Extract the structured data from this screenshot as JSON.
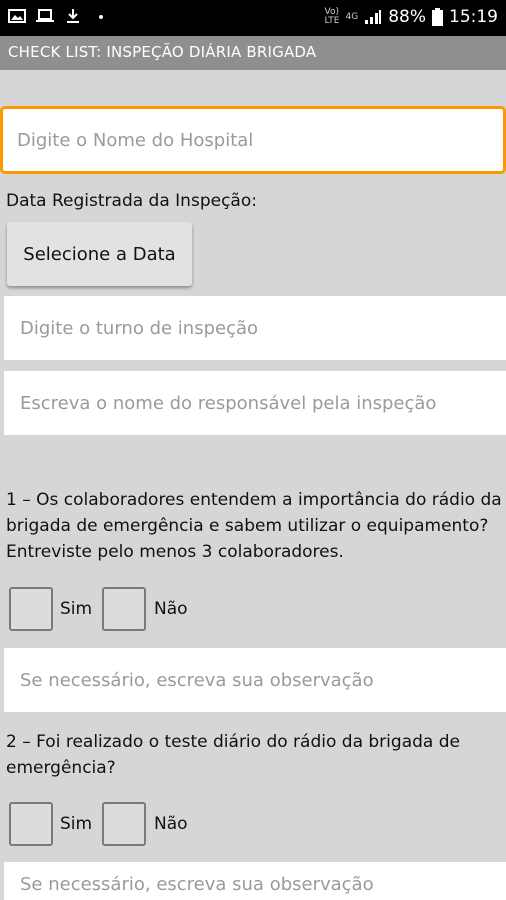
{
  "status_bar": {
    "network_top": "Vo)",
    "network_bottom": "LTE",
    "network_type": "4G",
    "battery": "88%",
    "time": "15:19"
  },
  "app_bar": {
    "title": "CHECK LIST: INSPEÇÃO DIÁRIA BRIGADA"
  },
  "form": {
    "hospital_placeholder": "Digite o Nome do Hospital",
    "date_label": "Data Registrada da Inspeção:",
    "date_button": "Selecione a Data",
    "shift_placeholder": "Digite o turno de inspeção",
    "responsible_placeholder": "Escreva o nome do responsável pela inspeção"
  },
  "questions": [
    {
      "lines": [
        "1 – Os colaboradores entendem a importância do rádio da",
        "brigada de emergência e sabem utilizar o equipamento?",
        "Entreviste pelo menos 3 colaboradores."
      ],
      "yes_label": "Sim",
      "no_label": "Não",
      "observation_placeholder": "Se necessário, escreva sua observação"
    },
    {
      "lines": [
        "2 – Foi realizado o teste diário do rádio da brigada de",
        "emergência?"
      ],
      "yes_label": "Sim",
      "no_label": "Não",
      "observation_placeholder": "Se necessário, escreva sua observação"
    }
  ],
  "colors": {
    "accent": "#ff9800",
    "app_bar": "#8f8f8f",
    "background": "#d6d6d6"
  },
  "icons": [
    "image-icon",
    "laptop-icon",
    "download-icon",
    "dot-icon",
    "signal-icon",
    "battery-icon"
  ]
}
